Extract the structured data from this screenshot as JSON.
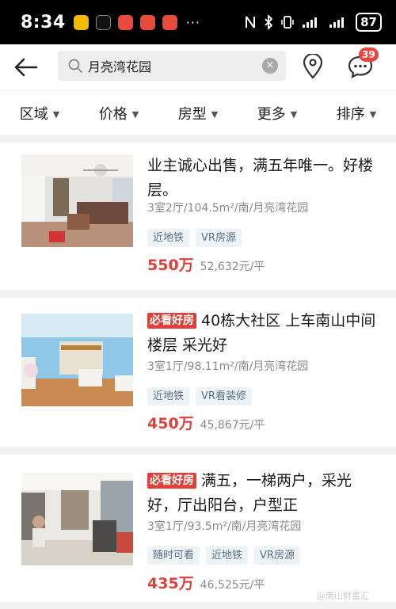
{
  "status_bar": {
    "time": "8:34",
    "more": "···",
    "battery": "87",
    "icons": [
      "nfc-icon",
      "bluetooth-icon",
      "vibrate-icon",
      "signal-icon",
      "wifi-icon"
    ]
  },
  "header": {
    "search_value": "月亮湾花园",
    "clear_icon": "×",
    "message_badge": "39"
  },
  "filters": [
    {
      "label": "区域"
    },
    {
      "label": "价格"
    },
    {
      "label": "房型"
    },
    {
      "label": "更多"
    },
    {
      "label": "排序"
    }
  ],
  "listings": [
    {
      "badge": "",
      "title": "业主诚心出售，满五年唯一。好楼层。",
      "meta": "3室2厅/104.5m²/南/月亮湾花园",
      "tags": [
        "近地铁",
        "VR房源"
      ],
      "price": "550万",
      "unit_price": "52,632元/平"
    },
    {
      "badge": "必看好房",
      "title": "40栋大社区 上车南山中间楼层 采光好",
      "meta": "3室1厅/98.11m²/南/月亮湾花园",
      "tags": [
        "近地铁",
        "VR看装修"
      ],
      "price": "450万",
      "unit_price": "45,867元/平"
    },
    {
      "badge": "必看好房",
      "title": "满五，一梯两户，采光好，厅出阳台，户型正",
      "meta": "3室1厅/93.5m²/南/月亮湾花园",
      "tags": [
        "随时可看",
        "近地铁",
        "VR房源"
      ],
      "price": "435万",
      "unit_price": "46,525元/平"
    }
  ],
  "watermark": "@南山财富汇",
  "colors": {
    "accent_red": "#e0403a",
    "tag_bg": "#eef3f8",
    "tag_text": "#5b6f86"
  }
}
